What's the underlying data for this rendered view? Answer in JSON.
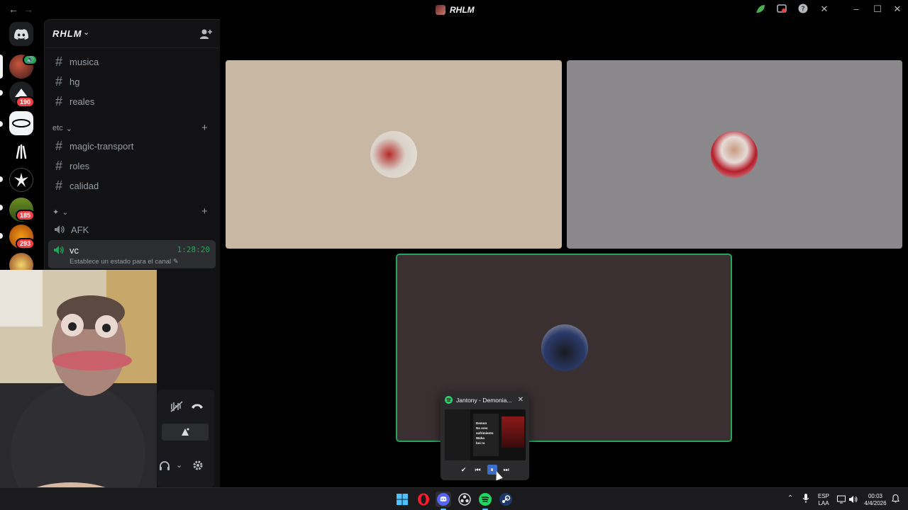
{
  "window": {
    "title": "RHLM"
  },
  "guild": {
    "name": "RHLM"
  },
  "channels": {
    "top": [
      {
        "name": "musica"
      },
      {
        "name": "hg"
      },
      {
        "name": "reales"
      }
    ],
    "category_etc": {
      "label": "etc"
    },
    "etc": [
      {
        "name": "magic-transport"
      },
      {
        "name": "roles"
      },
      {
        "name": "calidad"
      }
    ],
    "category_voice": {
      "label": "✦"
    },
    "voice": [
      {
        "name": "AFK"
      }
    ],
    "active_voice": {
      "name": "vc",
      "timer": "1:28:20",
      "status": "Establece un estado para el canal"
    }
  },
  "servers": {
    "badges": [
      "190",
      "185",
      "293"
    ]
  },
  "spotify": {
    "title": "Jantony - Demonia...",
    "preview_text": [
      "Demon",
      "No eres",
      "sufrimiento",
      "Waha",
      "boi ra"
    ]
  },
  "tray": {
    "lang_top": "ESP",
    "lang_bottom": "LAA",
    "time": "00:03",
    "date": "4/4/2026"
  },
  "colors": {
    "accent_green": "#23a55a",
    "badge_red": "#f23f43",
    "discord_blurple": "#5865f2",
    "spotify_green": "#1ed760"
  }
}
